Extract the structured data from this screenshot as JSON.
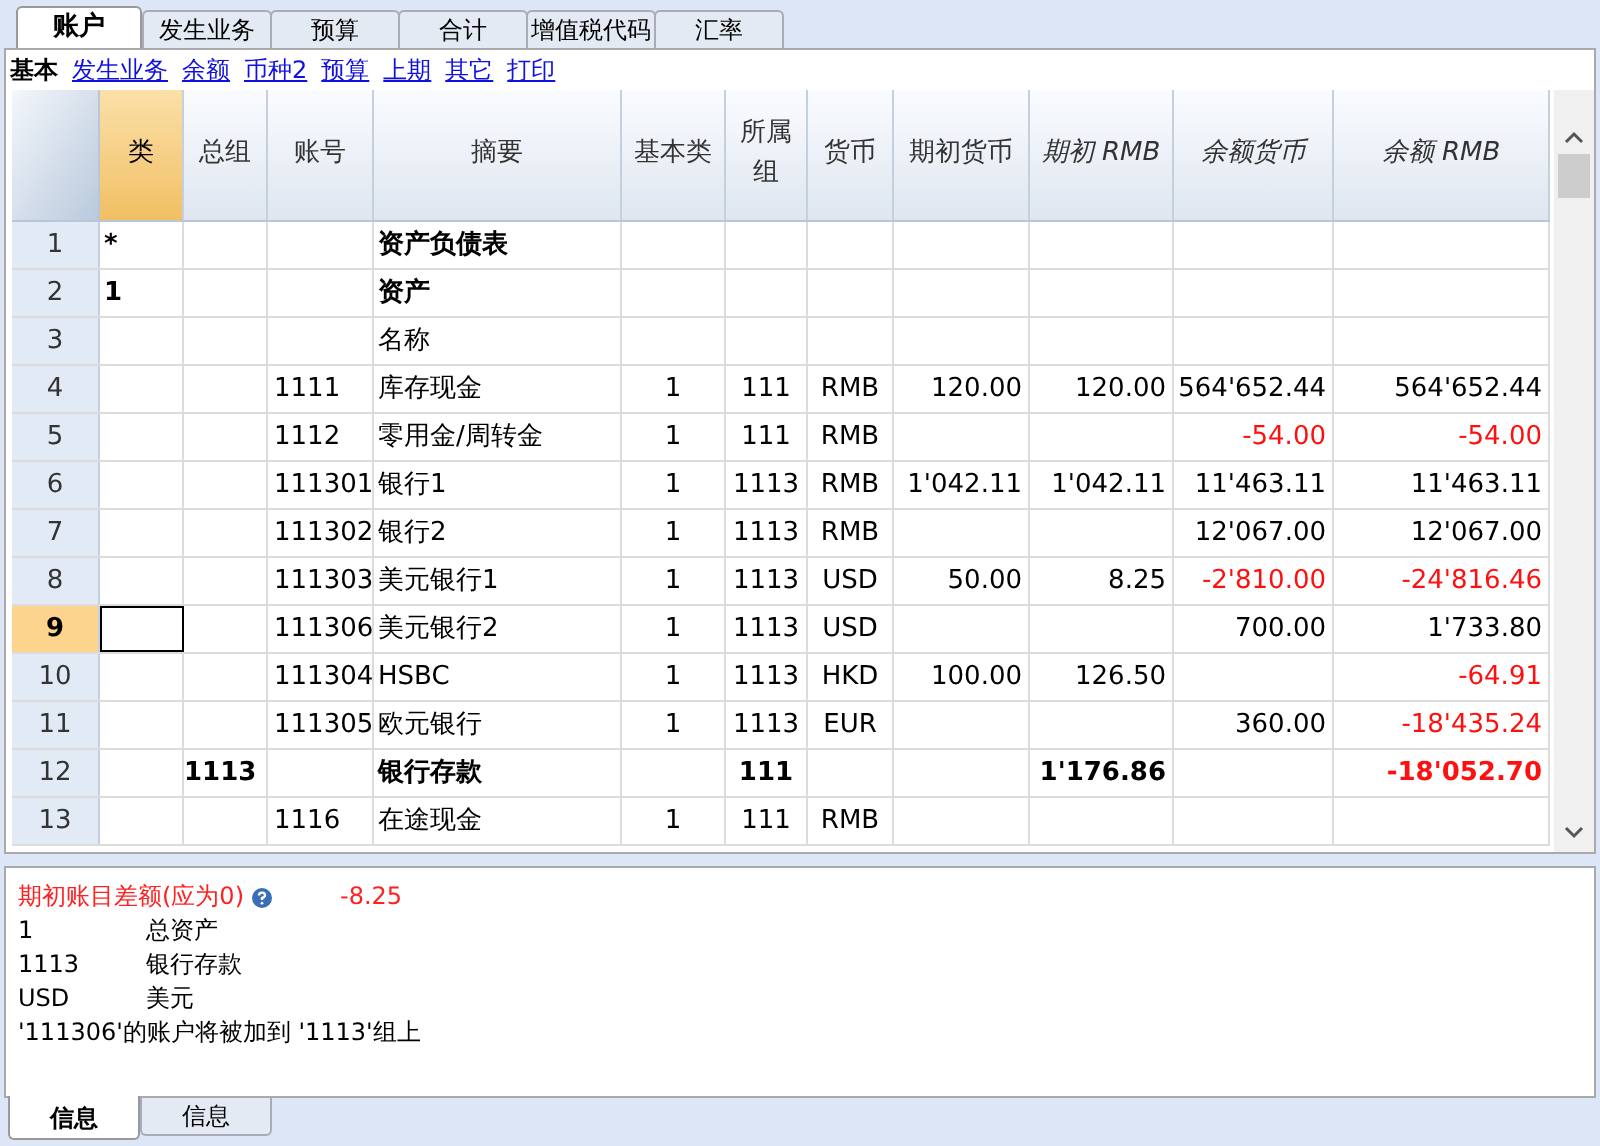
{
  "tabs": [
    {
      "label": "账户",
      "selected": true
    },
    {
      "label": "发生业务",
      "selected": false
    },
    {
      "label": "预算",
      "selected": false
    },
    {
      "label": "合计",
      "selected": false
    },
    {
      "label": "增值税代码",
      "selected": false
    },
    {
      "label": "汇率",
      "selected": false
    }
  ],
  "views": [
    {
      "label": "基本",
      "selected": true
    },
    {
      "label": "发生业务",
      "selected": false
    },
    {
      "label": "余额",
      "selected": false
    },
    {
      "label": "币种2",
      "selected": false
    },
    {
      "label": "预算",
      "selected": false
    },
    {
      "label": "上期",
      "selected": false
    },
    {
      "label": "其它",
      "selected": false
    },
    {
      "label": "打印",
      "selected": false
    }
  ],
  "columns": [
    {
      "label": "类",
      "selected": true,
      "italic": false
    },
    {
      "label": "总组",
      "selected": false,
      "italic": false
    },
    {
      "label": "账号",
      "selected": false,
      "italic": false
    },
    {
      "label": "摘要",
      "selected": false,
      "italic": false
    },
    {
      "label": "基本类",
      "selected": false,
      "italic": false
    },
    {
      "label": "所属组",
      "selected": false,
      "italic": false
    },
    {
      "label": "货币",
      "selected": false,
      "italic": false
    },
    {
      "label": "期初货币",
      "selected": false,
      "italic": false
    },
    {
      "label": "期初 RMB",
      "selected": false,
      "italic": true
    },
    {
      "label": "余额货币",
      "selected": false,
      "italic": true
    },
    {
      "label": "余额 RMB",
      "selected": false,
      "italic": true
    }
  ],
  "rows": [
    {
      "number": "1",
      "selected": false,
      "bold": true,
      "cells": [
        {
          "text": "*"
        },
        {},
        {},
        {
          "text": "资产负债表"
        },
        {},
        {},
        {},
        {},
        {},
        {},
        {}
      ]
    },
    {
      "number": "2",
      "selected": false,
      "bold": true,
      "cells": [
        {
          "text": "1"
        },
        {},
        {},
        {
          "text": "资产"
        },
        {},
        {},
        {},
        {},
        {},
        {},
        {}
      ]
    },
    {
      "number": "3",
      "selected": false,
      "bold": false,
      "cells": [
        {},
        {},
        {},
        {
          "text": "名称"
        },
        {},
        {},
        {},
        {},
        {},
        {},
        {}
      ]
    },
    {
      "number": "4",
      "selected": false,
      "bold": false,
      "cells": [
        {},
        {},
        {
          "text": "1111"
        },
        {
          "text": "库存现金"
        },
        {
          "text": "1"
        },
        {
          "text": "111"
        },
        {
          "text": "RMB"
        },
        {
          "text": "120.00"
        },
        {
          "text": "120.00"
        },
        {
          "text": "564'652.44",
          "negative": false
        },
        {
          "text": "564'652.44",
          "negative": false
        }
      ]
    },
    {
      "number": "5",
      "selected": false,
      "bold": false,
      "cells": [
        {},
        {},
        {
          "text": "1112"
        },
        {
          "text": "零用金/周转金"
        },
        {
          "text": "1"
        },
        {
          "text": "111"
        },
        {
          "text": "RMB"
        },
        {},
        {},
        {
          "text": "-54.00",
          "negative": true
        },
        {
          "text": "-54.00",
          "negative": true
        }
      ]
    },
    {
      "number": "6",
      "selected": false,
      "bold": false,
      "cells": [
        {},
        {},
        {
          "text": "111301"
        },
        {
          "text": "银行1"
        },
        {
          "text": "1"
        },
        {
          "text": "1113"
        },
        {
          "text": "RMB"
        },
        {
          "text": "1'042.11"
        },
        {
          "text": "1'042.11"
        },
        {
          "text": "11'463.11",
          "negative": false
        },
        {
          "text": "11'463.11",
          "negative": false
        }
      ]
    },
    {
      "number": "7",
      "selected": false,
      "bold": false,
      "cells": [
        {},
        {},
        {
          "text": "111302"
        },
        {
          "text": "银行2"
        },
        {
          "text": "1"
        },
        {
          "text": "1113"
        },
        {
          "text": "RMB"
        },
        {},
        {},
        {
          "text": "12'067.00",
          "negative": false
        },
        {
          "text": "12'067.00",
          "negative": false
        }
      ]
    },
    {
      "number": "8",
      "selected": false,
      "bold": false,
      "cells": [
        {},
        {},
        {
          "text": "111303"
        },
        {
          "text": "美元银行1"
        },
        {
          "text": "1"
        },
        {
          "text": "1113"
        },
        {
          "text": "USD"
        },
        {
          "text": "50.00"
        },
        {
          "text": "8.25"
        },
        {
          "text": "-2'810.00",
          "negative": true
        },
        {
          "text": "-24'816.46",
          "negative": true
        }
      ]
    },
    {
      "number": "9",
      "selected": true,
      "bold": false,
      "cells": [
        {},
        {},
        {
          "text": "111306"
        },
        {
          "text": "美元银行2"
        },
        {
          "text": "1"
        },
        {
          "text": "1113"
        },
        {
          "text": "USD"
        },
        {},
        {},
        {
          "text": "700.00",
          "negative": false
        },
        {
          "text": "1'733.80",
          "negative": false
        }
      ]
    },
    {
      "number": "10",
      "selected": false,
      "bold": false,
      "cells": [
        {},
        {},
        {
          "text": "111304"
        },
        {
          "text": "HSBC"
        },
        {
          "text": "1"
        },
        {
          "text": "1113"
        },
        {
          "text": "HKD"
        },
        {
          "text": "100.00"
        },
        {
          "text": "126.50"
        },
        {},
        {
          "text": "-64.91",
          "negative": true
        }
      ]
    },
    {
      "number": "11",
      "selected": false,
      "bold": false,
      "cells": [
        {},
        {},
        {
          "text": "111305"
        },
        {
          "text": "欧元银行"
        },
        {
          "text": "1"
        },
        {
          "text": "1113"
        },
        {
          "text": "EUR"
        },
        {},
        {},
        {
          "text": "360.00",
          "negative": false
        },
        {
          "text": "-18'435.24",
          "negative": true
        }
      ]
    },
    {
      "number": "12",
      "selected": false,
      "bold": true,
      "cells": [
        {},
        {
          "text": "1113"
        },
        {},
        {
          "text": "银行存款"
        },
        {},
        {
          "text": "111"
        },
        {},
        {},
        {
          "text": "1'176.86"
        },
        {},
        {
          "text": "-18'052.70",
          "negative": true
        }
      ]
    },
    {
      "number": "13",
      "selected": false,
      "bold": false,
      "cells": [
        {},
        {},
        {
          "text": "1116"
        },
        {
          "text": "在途现金"
        },
        {
          "text": "1"
        },
        {
          "text": "111"
        },
        {
          "text": "RMB"
        },
        {},
        {},
        {},
        {}
      ]
    }
  ],
  "info": {
    "warning": {
      "label": "期初账目差额(应为0)",
      "value": "-8.25"
    },
    "lines": [
      {
        "code": "1",
        "name": "总资产"
      },
      {
        "code": "1113",
        "name": "银行存款"
      },
      {
        "code": "USD",
        "name": "美元"
      }
    ],
    "message": "'111306'的账户将被加到 '1113'组上"
  },
  "bottom_tabs": [
    {
      "label": "信息",
      "selected": true
    },
    {
      "label": "信息",
      "selected": false
    }
  ]
}
